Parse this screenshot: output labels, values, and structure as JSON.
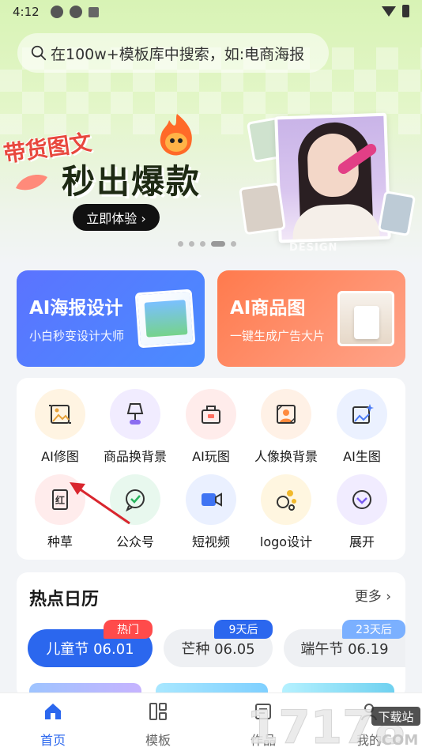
{
  "status_bar": {
    "time": "4:12"
  },
  "search": {
    "placeholder": "在100w+模板库中搜索，如:电商海报"
  },
  "banner": {
    "tag": "带货图文",
    "headline": "秒出爆款",
    "cta": "立即体验 ›",
    "watermark": "DESIGN",
    "carousel_total": 5,
    "carousel_active_index": 3
  },
  "feature_cards": [
    {
      "title": "AI海报设计",
      "subtitle": "小白秒变设计大师"
    },
    {
      "title": "AI商品图",
      "subtitle": "一键生成广告大片"
    }
  ],
  "tools": [
    {
      "label": "AI修图",
      "icon": "image-crop-icon",
      "bg": "#fff4e2",
      "fg": "#e6a23c"
    },
    {
      "label": "商品换背景",
      "icon": "lamp-icon",
      "bg": "#f1ecff",
      "fg": "#8b6cf0"
    },
    {
      "label": "AI玩图",
      "icon": "toolbox-icon",
      "bg": "#ffeceb",
      "fg": "#ff6f61"
    },
    {
      "label": "人像换背景",
      "icon": "portrait-icon",
      "bg": "#fff1e6",
      "fg": "#ff8a3d"
    },
    {
      "label": "AI生图",
      "icon": "image-sparkle-icon",
      "bg": "#ebf1ff",
      "fg": "#4b7bf5"
    },
    {
      "label": "种草",
      "icon": "red-note-icon",
      "bg": "#ffecec",
      "fg": "#333333"
    },
    {
      "label": "公众号",
      "icon": "wechat-icon",
      "bg": "#e8f8ee",
      "fg": "#27b35c"
    },
    {
      "label": "短视频",
      "icon": "video-camera-icon",
      "bg": "#eaf0ff",
      "fg": "#3f74f3"
    },
    {
      "label": "logo设计",
      "icon": "palette-icon",
      "bg": "#fff6e0",
      "fg": "#f1b92c"
    },
    {
      "label": "展开",
      "icon": "expand-chevron-icon",
      "bg": "#f1ecff",
      "fg": "#7a5cf0"
    }
  ],
  "calendar": {
    "title": "热点日历",
    "more": "更多 ›",
    "events": [
      {
        "label": "儿童节 06.01",
        "badge": "热门",
        "active": true
      },
      {
        "label": "芒种 06.05",
        "badge": "9天后",
        "active": false
      },
      {
        "label": "端午节 06.19",
        "badge": "23天后",
        "active": false
      }
    ]
  },
  "bottom_nav": [
    {
      "label": "首页",
      "icon": "home-icon",
      "active": true
    },
    {
      "label": "模板",
      "icon": "template-grid-icon",
      "active": false
    },
    {
      "label": "作品",
      "icon": "works-icon",
      "active": false
    },
    {
      "label": "我的",
      "icon": "profile-icon",
      "active": false
    }
  ],
  "overlay_watermark": {
    "text": "17178",
    "badge": "下载站",
    "domain": ".COM"
  },
  "colors": {
    "primary": "#2b67ee",
    "hot_badge": "#ff4b4b",
    "annotation_arrow": "#d9262e"
  }
}
